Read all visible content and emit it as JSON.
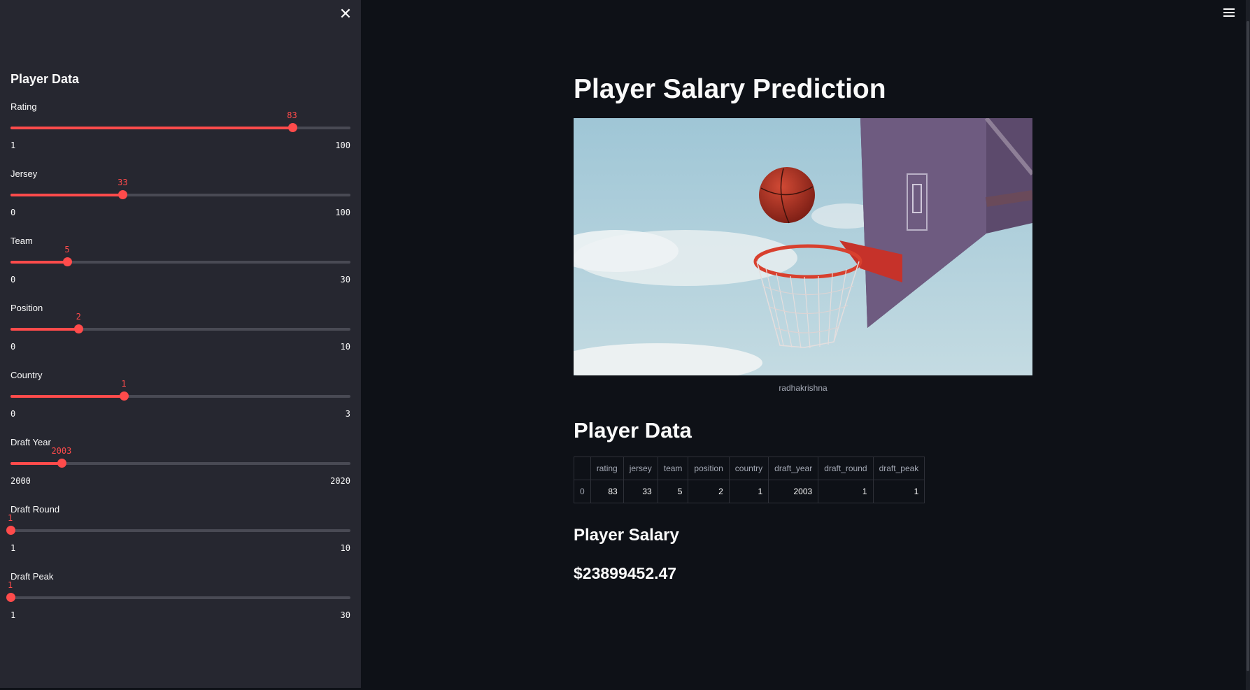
{
  "sidebar": {
    "title": "Player Data",
    "sliders": [
      {
        "label": "Rating",
        "value": 83,
        "min": 1,
        "max": 100
      },
      {
        "label": "Jersey",
        "value": 33,
        "min": 0,
        "max": 100
      },
      {
        "label": "Team",
        "value": 5,
        "min": 0,
        "max": 30
      },
      {
        "label": "Position",
        "value": 2,
        "min": 0,
        "max": 10
      },
      {
        "label": "Country",
        "value": 1,
        "min": 0,
        "max": 3
      },
      {
        "label": "Draft Year",
        "value": 2003,
        "min": 2000,
        "max": 2020
      },
      {
        "label": "Draft Round",
        "value": 1,
        "min": 1,
        "max": 10
      },
      {
        "label": "Draft Peak",
        "value": 1,
        "min": 1,
        "max": 30
      }
    ]
  },
  "main": {
    "title": "Player Salary Prediction",
    "image_caption": "radhakrishna",
    "data_section_title": "Player Data",
    "table": {
      "columns": [
        "",
        "rating",
        "jersey",
        "team",
        "position",
        "country",
        "draft_year",
        "draft_round",
        "draft_peak"
      ],
      "rows": [
        [
          "0",
          "83",
          "33",
          "5",
          "2",
          "1",
          "2003",
          "1",
          "1"
        ]
      ]
    },
    "salary_section_title": "Player Salary",
    "salary_value": "$23899452.47"
  },
  "colors": {
    "accent": "#ff4b4b",
    "background": "#0e1117",
    "sidebar": "#262730"
  },
  "icons": {
    "close": "close-icon",
    "menu": "hamburger-menu-icon"
  }
}
